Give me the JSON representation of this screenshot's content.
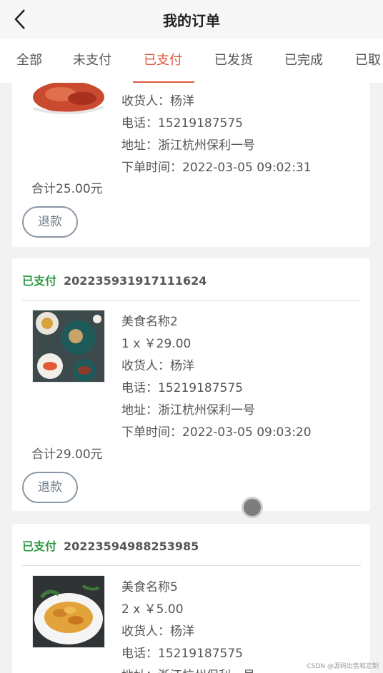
{
  "header": {
    "title": "我的订单"
  },
  "tabs": [
    "全部",
    "未支付",
    "已支付",
    "已发货",
    "已完成",
    "已取"
  ],
  "orders": [
    {
      "status": "",
      "order_no": "",
      "name": "",
      "qty_price": "",
      "receiver": "收货人：杨洋",
      "phone": "电话：15219187575",
      "address": "地址：浙江杭州保利一号",
      "time": "下单时间：2022-03-05 09:02:31",
      "total": "合计25.00元",
      "refund": "退款"
    },
    {
      "status": "已支付",
      "order_no": "20223593191711162 4",
      "name": "美食名称2",
      "qty_price": "1 x ￥29.00",
      "receiver": "收货人：杨洋",
      "phone": "电话：15219187575",
      "address": "地址：浙江杭州保利一号",
      "time": "下单时间：2022-03-05 09:03:20",
      "total": "合计29.00元",
      "refund": "退款"
    },
    {
      "status": "已支付",
      "order_no": "20223594988253985",
      "name": "美食名称5",
      "qty_price": "2 x ￥5.00",
      "receiver": "收货人：杨洋",
      "phone": "电话：15219187575",
      "address": "地址：浙江杭州保利一号",
      "time": "",
      "total": "",
      "refund": ""
    }
  ],
  "watermark": "CSDN @源码出售和定制",
  "colors": {
    "active_tab": "#e0553e",
    "paid_status": "#2e9a45",
    "refund_border": "#8a96a3"
  }
}
